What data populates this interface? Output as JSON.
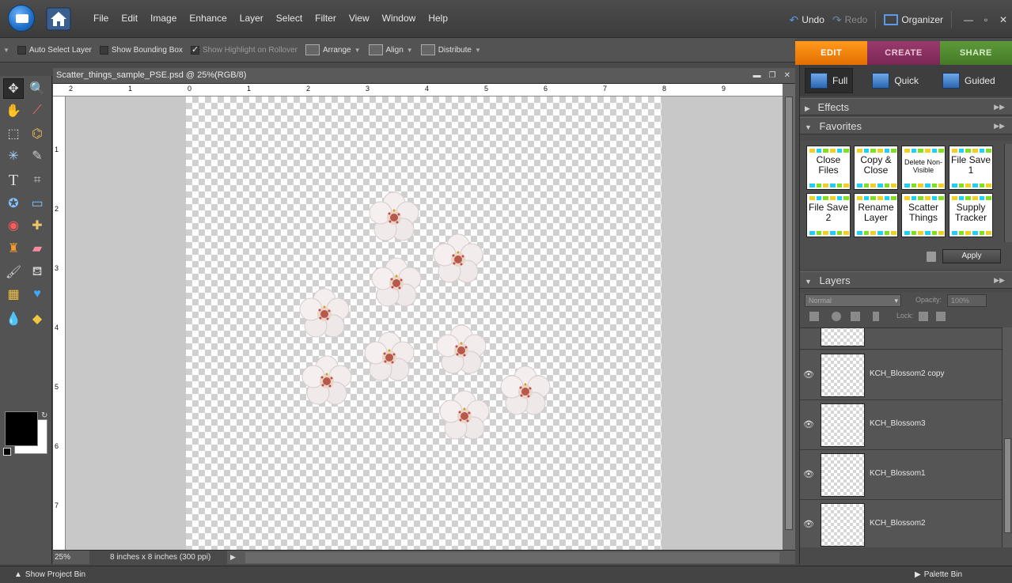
{
  "menu": [
    "File",
    "Edit",
    "Image",
    "Enhance",
    "Layer",
    "Select",
    "Filter",
    "View",
    "Window",
    "Help"
  ],
  "top_right": {
    "undo": "Undo",
    "redo": "Redo",
    "organizer": "Organizer"
  },
  "options_bar": {
    "auto_select": "Auto Select Layer",
    "bounding_box": "Show Bounding Box",
    "highlight": "Show Highlight on Rollover",
    "arrange": "Arrange",
    "align": "Align",
    "distribute": "Distribute"
  },
  "mode_tabs": [
    "EDIT",
    "CREATE",
    "SHARE"
  ],
  "document": {
    "title": "Scatter_things_sample_PSE.psd @ 25%(RGB/8)",
    "zoom": "25%",
    "info": "8 inches x 8 inches (300 ppi)",
    "ruler_h": [
      "2",
      "1",
      "0",
      "1",
      "2",
      "3",
      "4",
      "5",
      "6",
      "7",
      "8",
      "9"
    ],
    "ruler_v": [
      "1",
      "2",
      "3",
      "4",
      "5",
      "6",
      "7"
    ]
  },
  "right_panel": {
    "modes": {
      "full": "Full",
      "quick": "Quick",
      "guided": "Guided"
    },
    "effects": "Effects",
    "favorites": "Favorites",
    "favorite_items": [
      "Close Files",
      "Copy & Close",
      "Delete Non-Visible",
      "File Save 1",
      "File Save 2",
      "Rename Layer",
      "Scatter Things",
      "Supply Tracker"
    ],
    "apply": "Apply",
    "layers": "Layers",
    "blend_mode": "Normal",
    "opacity_label": "Opacity:",
    "opacity_value": "100%",
    "lock_label": "Lock:",
    "layer_names": [
      "KCH_Blossom2 copy",
      "KCH_Blossom3",
      "KCH_Blossom1",
      "KCH_Blossom2"
    ]
  },
  "bottom": {
    "project_bin": "Show Project Bin",
    "palette_bin": "Palette Bin"
  }
}
